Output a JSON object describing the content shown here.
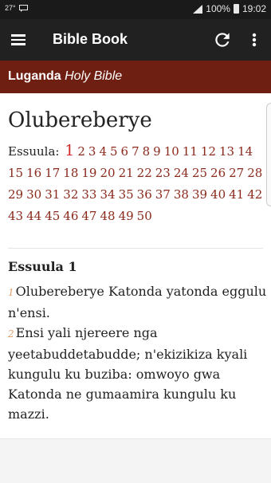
{
  "status_bar": {
    "left_temp": "27°",
    "battery_percent": "100%",
    "time": "19:02"
  },
  "app_bar": {
    "title": "Bible Book",
    "icons": [
      "menu-icon",
      "refresh-icon",
      "more-vert-icon"
    ]
  },
  "sub_header": {
    "language": "Luganda",
    "subtitle": "Holy Bible"
  },
  "content": {
    "book_title": "Olubereberye",
    "chapters_label": "Essuula:",
    "active_chapter": "1",
    "chapters": [
      "1",
      "2",
      "3",
      "4",
      "5",
      "6",
      "7",
      "8",
      "9",
      "10",
      "11",
      "12",
      "13",
      "14",
      "15",
      "16",
      "17",
      "18",
      "19",
      "20",
      "21",
      "22",
      "23",
      "24",
      "25",
      "26",
      "27",
      "28",
      "29",
      "30",
      "31",
      "32",
      "33",
      "34",
      "35",
      "36",
      "37",
      "38",
      "39",
      "40",
      "41",
      "42",
      "43",
      "44",
      "45",
      "46",
      "47",
      "48",
      "49",
      "50"
    ],
    "chapter_heading": "Essuula 1",
    "verses": [
      {
        "num": "1",
        "text": "Olubereberye Katonda yatonda eggulu n'ensi."
      },
      {
        "num": "2",
        "text": "Ensi yali njereere nga yeetabuddetabudde; n'ekizikiza kyali kungulu ku buziba: omwoyo gwa Katonda ne gumaamira kungulu ku mazzi."
      }
    ]
  },
  "colors": {
    "app_bar": "#212121",
    "sub_header": "#6e1f12",
    "chapter_link": "#8b2a1c",
    "active_chapter": "#d12b2b",
    "verse_number": "#e0a070"
  }
}
